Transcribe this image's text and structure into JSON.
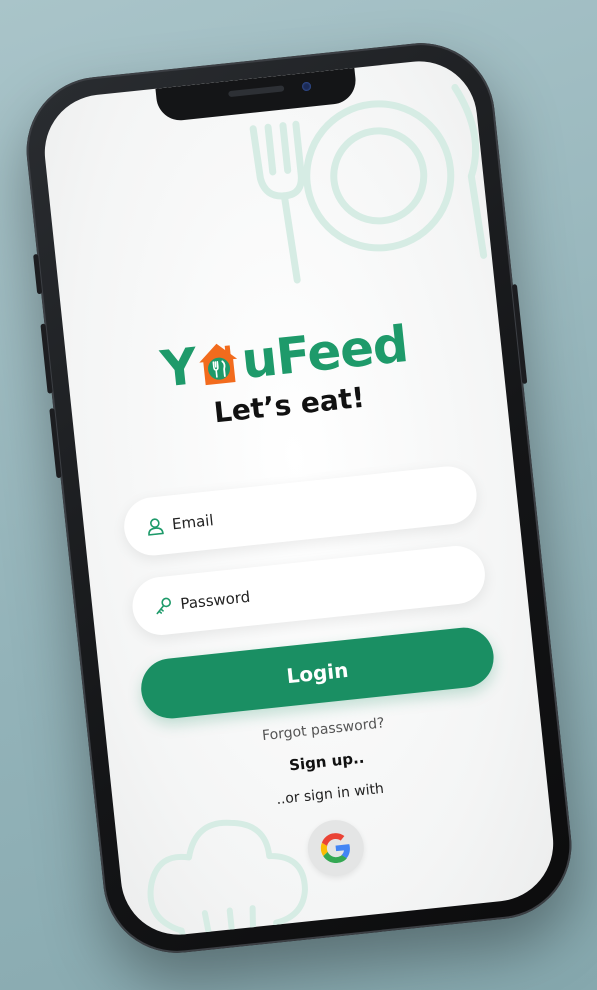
{
  "app": {
    "logo_text_left": "Y",
    "logo_text_right": "uFeed",
    "tagline": "Let’s eat!"
  },
  "form": {
    "email_placeholder": "Email",
    "password_placeholder": "Password",
    "login_label": "Login"
  },
  "links": {
    "forgot_password": "Forgot password?",
    "sign_up": "Sign up..",
    "or_sign_in_with": "..or sign in with"
  },
  "icons": {
    "email": "user-icon",
    "password": "key-icon",
    "google": "google-icon",
    "logo_house": "house-fork-spoon-icon"
  },
  "colors": {
    "brand_green": "#1e9a6a",
    "button_green": "#1a8f63",
    "logo_orange": "#f26b1d",
    "background": "#9bbabf"
  }
}
